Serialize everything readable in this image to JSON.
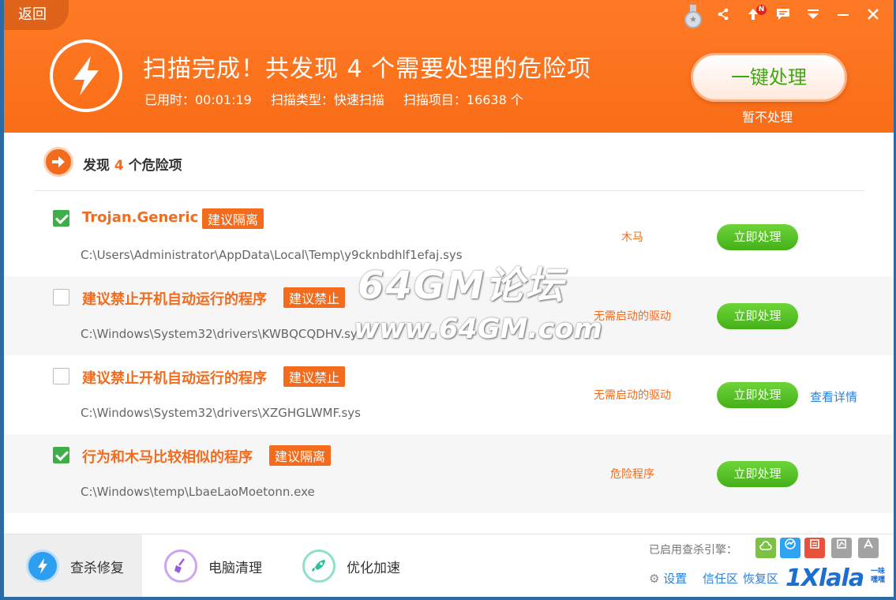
{
  "header": {
    "back_label": "返回",
    "title": "扫描完成！共发现 4 个需要处理的危险项",
    "elapsed": "已用时：00:01:19",
    "scan_type": "扫描类型：快速扫描",
    "scan_items": "扫描项目：16638 个",
    "fix_all_label": "一键处理",
    "skip_label": "暂不处理",
    "notification_badge": "N",
    "icons": [
      "medal-icon",
      "share-icon",
      "update-icon",
      "feedback-icon",
      "menu-icon",
      "minimize-icon",
      "close-icon"
    ]
  },
  "summary": {
    "prefix": "发现",
    "count": "4",
    "suffix": "个危险项"
  },
  "threats": [
    {
      "checked": true,
      "name": "Trojan.Generic",
      "tag": "建议隔离",
      "path": "C:\\Users\\Administrator\\AppData\\Local\\Temp\\y9cknbdhlf1efaj.sys",
      "type": "木马",
      "action": "立即处理",
      "detail": ""
    },
    {
      "checked": false,
      "name": "建议禁止开机自动运行的程序",
      "tag": "建议禁止",
      "path": "C:\\Windows\\System32\\drivers\\KWBQCQDHV.sys",
      "type": "无需启动的驱动",
      "action": "立即处理",
      "detail": ""
    },
    {
      "checked": false,
      "name": "建议禁止开机自动运行的程序",
      "tag": "建议禁止",
      "path": "C:\\Windows\\System32\\drivers\\XZGHGLWMF.sys",
      "type": "无需启动的驱动",
      "action": "立即处理",
      "detail": "查看详情"
    },
    {
      "checked": true,
      "name": "行为和木马比较相似的程序",
      "tag": "建议隔离",
      "path": "C:\\Windows\\temp\\LbaeLaoMoetonn.exe",
      "type": "危险程序",
      "action": "立即处理",
      "detail": ""
    }
  ],
  "watermark": {
    "line1": "64GM论坛",
    "line2": "www.64GM.com"
  },
  "footer": {
    "tabs": [
      {
        "label": "查杀修复",
        "icon": "bolt-icon",
        "active": true
      },
      {
        "label": "电脑清理",
        "icon": "broom-icon",
        "active": false
      },
      {
        "label": "优化加速",
        "icon": "rocket-icon",
        "active": false
      }
    ],
    "engines_label": "已启用查杀引擎：",
    "engines": [
      {
        "name": "cloud-engine-icon",
        "color": "#7cc242"
      },
      {
        "name": "qvm-engine-icon",
        "color": "#2ea3f2"
      },
      {
        "name": "qex-engine-icon",
        "color": "#e8523b"
      },
      {
        "name": "kernel-engine-icon",
        "color": "#9a9a9a"
      },
      {
        "name": "avira-engine-icon",
        "color": "#9a9a9a"
      }
    ],
    "settings_label": "设置",
    "trust_label": "信任区",
    "restore_label": "恢复区"
  },
  "brand": {
    "text": "1Xlala",
    "sub": "一味 嘿嘿"
  },
  "colors": {
    "accent": "#f36b1d",
    "header": "#f96d17",
    "action_green": "#44b018",
    "link_blue": "#2f7fd6"
  }
}
